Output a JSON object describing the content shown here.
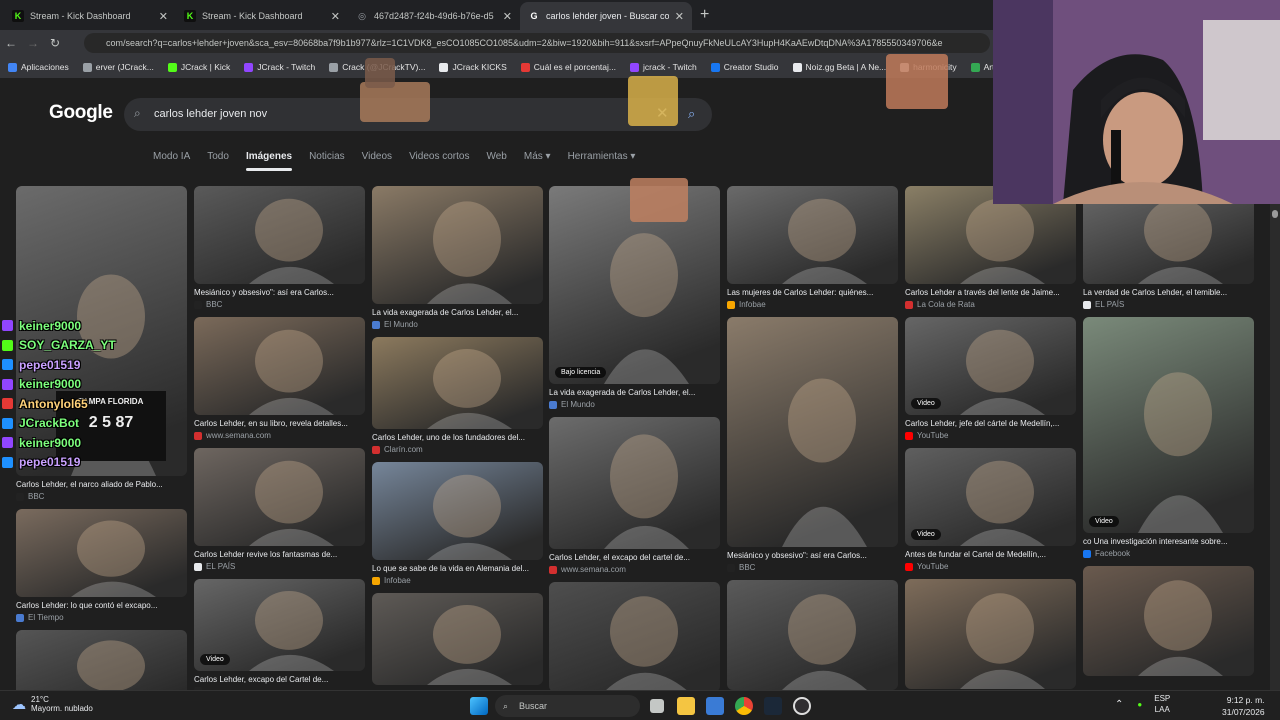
{
  "tabs": [
    {
      "title": "Stream - Kick Dashboard",
      "favicon_color": "#53fc18",
      "glyph": "K"
    },
    {
      "title": "Stream - Kick Dashboard",
      "favicon_color": "#53fc18",
      "glyph": "K"
    },
    {
      "title": "467d2487-f24b-49d6-b76e-d5",
      "favicon_color": "#9aa0a6",
      "glyph": "◎"
    },
    {
      "title": "carlos lehder joven - Buscar con",
      "favicon_color": "#ffffff",
      "glyph": "G"
    }
  ],
  "address": {
    "url": "com/search?q=carlos+lehder+joven&sca_esv=80668ba7f9b1b977&rlz=1C1VDK8_esCO1085CO1085&udm=2&biw=1920&bih=911&sxsrf=APpeQnuyFkNeULcAY3HupH4KaAEwDtqDNA%3A1785550349706&e"
  },
  "bookmarks": [
    {
      "label": "Aplicaciones",
      "color": "#4285f4"
    },
    {
      "label": "erver (JCrack...",
      "color": "#9aa0a6"
    },
    {
      "label": "JCrack | Kick",
      "color": "#53fc18"
    },
    {
      "label": "JCrack - Twitch",
      "color": "#9146ff"
    },
    {
      "label": "Crack (@JCrackTV)...",
      "color": "#9aa0a6"
    },
    {
      "label": "JCrack KICKS",
      "color": "#e8eaed"
    },
    {
      "label": "Cuál es el porcentaj...",
      "color": "#e53935"
    },
    {
      "label": "jcrack - Twitch",
      "color": "#9146ff"
    },
    {
      "label": "Creator Studio",
      "color": "#1877f2"
    },
    {
      "label": "Noiz.gg Beta | A Ne...",
      "color": "#e8eaed"
    },
    {
      "label": "harmonicity",
      "color": "#e8eaed"
    },
    {
      "label": "Articu",
      "color": "#34a853"
    }
  ],
  "google": {
    "logo": "Google",
    "query": "carlos lehder joven nov",
    "nav": [
      "Modo IA",
      "Todo",
      "Imágenes",
      "Noticias",
      "Videos",
      "Videos cortos",
      "Web",
      "Más ▾",
      "Herramientas ▾"
    ],
    "active_nav": "Imágenes"
  },
  "columns": [
    [
      {
        "caption": "Carlos Lehder, el narco aliado de Pablo...",
        "source": "BBC",
        "src_color": "#222",
        "h": 290,
        "tone": "#6b6b6b",
        "badge": ""
      },
      {
        "caption": "Carlos Lehder: lo que contó el excapo...",
        "source": "El Tiempo",
        "src_color": "#4a7bd0",
        "h": 88,
        "tone": "#7a6b5e",
        "badge": ""
      },
      {
        "caption": "",
        "source": "",
        "src_color": "#222",
        "h": 80,
        "tone": "#555",
        "badge": ""
      }
    ],
    [
      {
        "caption": "Mesiánico y obsesivo\": así era Carlos...",
        "source": "BBC",
        "src_color": "#222",
        "h": 98,
        "tone": "#5a5a5a",
        "badge": ""
      },
      {
        "caption": "Carlos Lehder, en su libro, revela detalles...",
        "source": "www.semana.com",
        "src_color": "#d32f2f",
        "h": 98,
        "tone": "#7b6a5a",
        "badge": ""
      },
      {
        "caption": "Carlos Lehder revive los fantasmas de...",
        "source": "EL PAÍS",
        "src_color": "#e8eaed",
        "h": 98,
        "tone": "#6e6660",
        "badge": ""
      },
      {
        "caption": "Carlos Lehder, excapo del Cartel de...",
        "source": "",
        "src_color": "#222",
        "h": 92,
        "tone": "#666",
        "badge": "Video"
      }
    ],
    [
      {
        "caption": "La vida exagerada de Carlos Lehder, el...",
        "source": "El Mundo",
        "src_color": "#4a7bd0",
        "h": 118,
        "tone": "#8a7a66",
        "badge": ""
      },
      {
        "caption": "Carlos Lehder, uno de los fundadores del...",
        "source": "Clarín.com",
        "src_color": "#d32f2f",
        "h": 92,
        "tone": "#8c7a5e",
        "badge": ""
      },
      {
        "caption": "Lo que se sabe de la vida en Alemania del...",
        "source": "Infobae",
        "src_color": "#f7a600",
        "h": 98,
        "tone": "#76869a",
        "badge": ""
      },
      {
        "caption": "",
        "source": "",
        "src_color": "#222",
        "h": 92,
        "tone": "#5e5a56",
        "badge": ""
      }
    ],
    [
      {
        "caption": "La vida exagerada de Carlos Lehder, el...",
        "source": "El Mundo",
        "src_color": "#4a7bd0",
        "h": 198,
        "tone": "#7a7a7a",
        "badge": "Bajo licencia"
      },
      {
        "caption": "Carlos Lehder, el excapo del cartel de...",
        "source": "www.semana.com",
        "src_color": "#d32f2f",
        "h": 132,
        "tone": "#6c6c6c",
        "badge": ""
      },
      {
        "caption": "",
        "source": "",
        "src_color": "#222",
        "h": 110,
        "tone": "#4e4e4e",
        "badge": ""
      }
    ],
    [
      {
        "caption": "Las mujeres de Carlos Lehder: quiénes...",
        "source": "Infobae",
        "src_color": "#f7a600",
        "h": 98,
        "tone": "#6a6a6a",
        "badge": ""
      },
      {
        "caption": "Mesiánico y obsesivo\": así era Carlos...",
        "source": "BBC",
        "src_color": "#222",
        "h": 230,
        "tone": "#8a7b6a",
        "badge": ""
      },
      {
        "caption": "",
        "source": "",
        "src_color": "#222",
        "h": 110,
        "tone": "#5a5a5a",
        "badge": ""
      }
    ],
    [
      {
        "caption": "Carlos Lehder a través del lente de Jaime...",
        "source": "La Cola de Rata",
        "src_color": "#d32f2f",
        "h": 98,
        "tone": "#8a7f66",
        "badge": ""
      },
      {
        "caption": "Carlos Lehder, jefe del cártel de Medellín,...",
        "source": "YouTube",
        "src_color": "#ff0000",
        "h": 98,
        "tone": "#666",
        "badge": "Video"
      },
      {
        "caption": "Antes de fundar el Cartel de Medellín,...",
        "source": "YouTube",
        "src_color": "#ff0000",
        "h": 98,
        "tone": "#5f5f5f",
        "badge": "Video"
      },
      {
        "caption": "",
        "source": "",
        "src_color": "#222",
        "h": 110,
        "tone": "#7e6c5a",
        "badge": ""
      }
    ],
    [
      {
        "caption": "La verdad de Carlos Lehder, el temible...",
        "source": "EL PAÍS",
        "src_color": "#e8eaed",
        "h": 98,
        "tone": "#6a6a6a",
        "badge": ""
      },
      {
        "caption": "co Una investigación interesante sobre...",
        "source": "Facebook",
        "src_color": "#1877f2",
        "h": 216,
        "tone": "#7a8a7a",
        "badge": "Video"
      },
      {
        "caption": "",
        "source": "",
        "src_color": "#222",
        "h": 110,
        "tone": "#6a5a4e",
        "badge": ""
      }
    ]
  ],
  "chat": [
    {
      "user": "keiner9000",
      "color": "#7dff7d",
      "icon": "#9146ff"
    },
    {
      "user": "SOY_GARZA_YT",
      "color": "#7dff7d",
      "icon": "#53fc18"
    },
    {
      "user": "pepe01519",
      "color": "#c9a0ff",
      "icon": "#1e90ff"
    },
    {
      "user": "keiner9000",
      "color": "#7dff7d",
      "icon": "#9146ff"
    },
    {
      "user": "Antonylol65",
      "color": "#ffd27a",
      "icon": "#e53935"
    },
    {
      "user": "JCrackBot",
      "color": "#7dff7d",
      "icon": "#1e90ff"
    },
    {
      "user": "keiner9000",
      "color": "#7dff7d",
      "icon": "#9146ff"
    },
    {
      "user": "pepe01519",
      "color": "#c9a0ff",
      "icon": "#1e90ff"
    }
  ],
  "mugshot_text": {
    "line1": "TAMPA  FLORIDA",
    "line2": "2 5 87"
  },
  "taskbar": {
    "weather_temp": "21°C",
    "weather_desc": "Mayorm. nublado",
    "search_label": "Buscar",
    "lang_top": "ESP",
    "lang_bottom": "LAA",
    "time": "9:12 p. m.",
    "date": "31/07/2026"
  }
}
